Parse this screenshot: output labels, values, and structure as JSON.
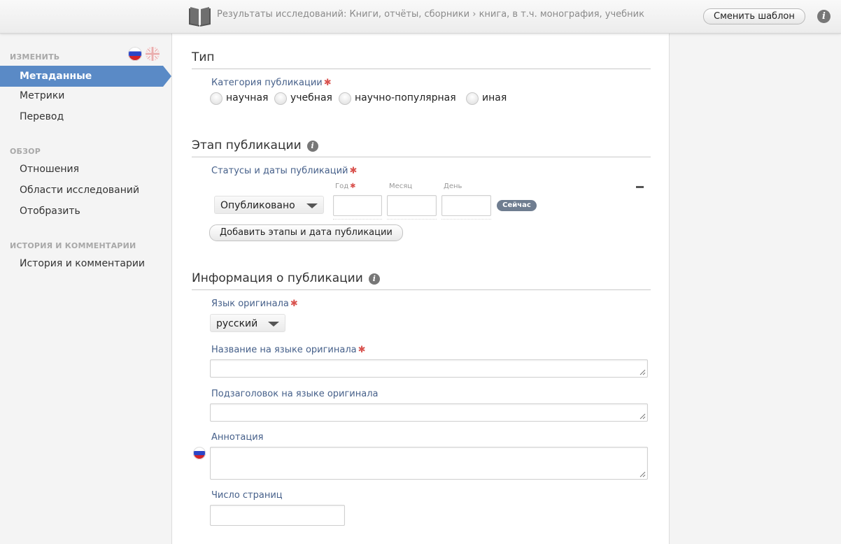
{
  "header": {
    "breadcrumb": "Результаты исследований: Книги, отчёты, сборники › книга, в т.ч. монография, учебник",
    "change_template_label": "Сменить шаблон",
    "info_glyph": "i",
    "book_icon": "book-icon"
  },
  "sidebar": {
    "groups": [
      {
        "label": "ИЗМЕНИТЬ",
        "items": [
          {
            "label": "Метаданные",
            "active": true
          },
          {
            "label": "Метрики"
          },
          {
            "label": "Перевод"
          }
        ]
      },
      {
        "label": "ОБЗОР",
        "items": [
          {
            "label": "Отношения"
          },
          {
            "label": "Области исследований"
          },
          {
            "label": "Отобразить"
          }
        ]
      },
      {
        "label": "ИСТОРИЯ И КОММЕНТАРИИ",
        "items": [
          {
            "label": "История и комментарии"
          }
        ]
      }
    ],
    "language_flags": [
      "russia-flag-icon",
      "uk-flag-icon"
    ]
  },
  "type_section": {
    "title": "Тип",
    "category_label": "Категория публикации",
    "required_mark": "✱",
    "options": [
      "научная",
      "учебная",
      "научно-популярная",
      "иная"
    ]
  },
  "stage_section": {
    "title": "Этап публикации",
    "statuses_label": "Статусы и даты публикаций",
    "status_value": "Опубликовано",
    "year_label": "Год",
    "month_label": "Месяц",
    "day_label": "День",
    "now_button": "Сейчас",
    "add_button": "Добавить этапы и дата публикации",
    "remove_glyph": "−"
  },
  "info_section": {
    "title": "Информация о публикации",
    "language_label": "Язык оригинала",
    "language_value": "русский",
    "title_label": "Название на языке оригинала",
    "subtitle_label": "Подзаголовок на языке оригинала",
    "abstract_label": "Аннотация",
    "pages_label": "Число страниц"
  },
  "colors": {
    "accent": "#5a8ac6",
    "label": "#46608a",
    "required": "#d9534f"
  }
}
